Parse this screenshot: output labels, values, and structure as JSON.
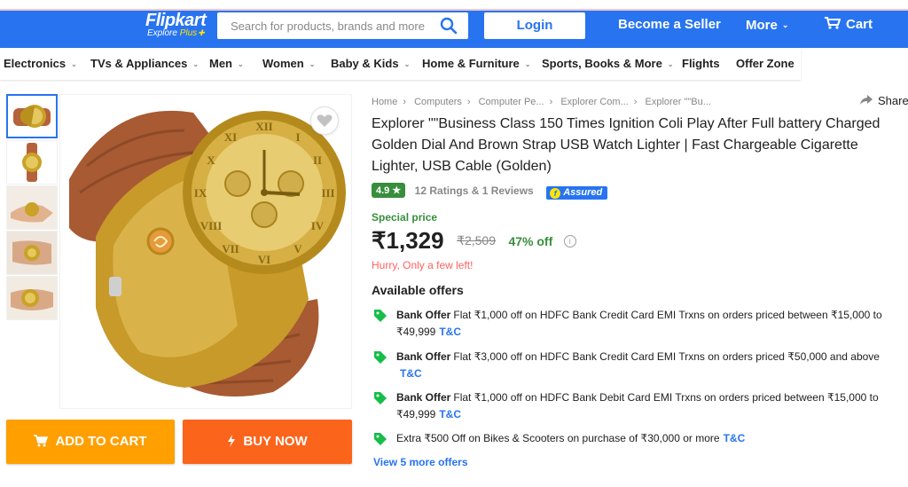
{
  "header": {
    "logo": "Flipkart",
    "logo_sub_a": "Explore",
    "logo_sub_b": "Plus",
    "search_placeholder": "Search for products, brands and more",
    "login": "Login",
    "become_seller": "Become a Seller",
    "more": "More",
    "cart": "Cart"
  },
  "categories": [
    "Electronics",
    "TVs & Appliances",
    "Men",
    "Women",
    "Baby & Kids",
    "Home & Furniture",
    "Sports, Books & More",
    "Flights",
    "Offer Zone"
  ],
  "breadcrumbs": [
    "Home",
    "Computers",
    "Computer Pe...",
    "Explorer Com...",
    "Explorer \"\"Bu..."
  ],
  "share": "Share",
  "product": {
    "title": "Explorer \"\"Business Class 150 Times Ignition Coli Play After Full battery Charged Golden Dial And Brown Strap USB Watch Lighter | Fast Chargeable Cigarette Lighter, USB Cable  (Golden)",
    "rating": "4.9 ★",
    "rating_text": "12 Ratings & 1 Reviews",
    "assured": "Assured",
    "special": "Special price",
    "price": "₹1,329",
    "mrp": "₹2,509",
    "off": "47% off",
    "hurry": "Hurry, Only a few left!"
  },
  "offers": {
    "title": "Available offers",
    "items": [
      {
        "type": "Bank Offer",
        "text": "Flat ₹1,000 off on HDFC Bank Credit Card EMI Trxns on orders priced between ₹15,000 to ₹49,999",
        "tnc": "T&C"
      },
      {
        "type": "Bank Offer",
        "text": "Flat ₹3,000 off on HDFC Bank Credit Card EMI Trxns on orders priced ₹50,000 and above",
        "tnc": "T&C"
      },
      {
        "type": "Bank Offer",
        "text": "Flat ₹1,000 off on HDFC Bank Debit Card EMI Trxns on orders priced between ₹15,000 to ₹49,999",
        "tnc": "T&C"
      },
      {
        "type": "",
        "text": "Extra ₹500 Off on Bikes & Scooters on purchase of ₹30,000 or more",
        "tnc": "T&C"
      }
    ],
    "more": "View 5 more offers"
  },
  "buttons": {
    "add_to_cart": "ADD TO CART",
    "buy_now": "BUY NOW"
  },
  "colors": {
    "brand_blue": "#2874f0",
    "cart_orange": "#ff9f00",
    "buy_orange": "#fb641b",
    "green": "#388e3c",
    "hurry_red": "#ff6161"
  }
}
